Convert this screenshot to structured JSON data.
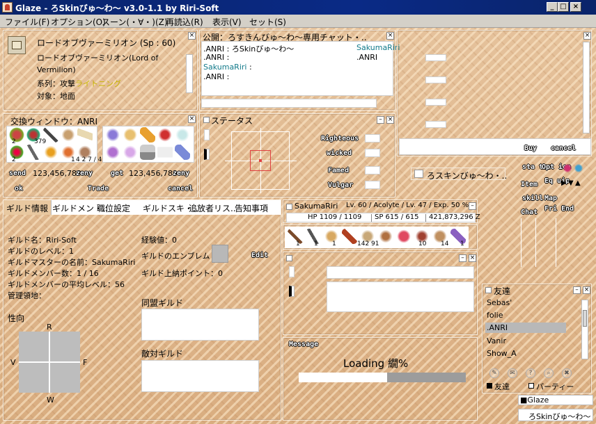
{
  "window": {
    "title": "Glaze - ろSkinびゅ～わ～ v3.0-1.1 by Riri-Soft",
    "min_icon": "minimize-icon",
    "max_icon": "maximize-icon",
    "close_icon": "close-icon"
  },
  "menu": [
    "ファイル(F)",
    "オプション(O)",
    "スーン(・∀・)(Z)",
    "再読込(R)",
    "表示(V)",
    "セット(S)"
  ],
  "skill_window": {
    "name": "ロードオブヴァーミリオン (Sp : 60)",
    "desc1": "ロードオブヴァーミリオン(Lord of",
    "desc2": "Vermilion)",
    "type_label": "系列：攻撃",
    "type_value": "ライトニング",
    "target": "対象：地面"
  },
  "chat_window": {
    "title": "公開：ろすきんびゅ～わ～専用チャット・..",
    "lines": [
      {
        "speaker": ".ANRI",
        "text": ": ろSkinびゅ～わ～",
        "speaker2": "SakumaRiri"
      },
      {
        "speaker": ".ANRI",
        "text": ":",
        "speaker2": ".ANRI"
      },
      {
        "speaker": "SakumaRiri",
        "text": ":",
        "speaker2": ""
      },
      {
        "speaker": ".ANRI",
        "text": ":",
        "speaker2": ""
      }
    ]
  },
  "trade_window": {
    "title": "交換ウィンドウ：ANRI",
    "left_counts": [
      "2",
      "379",
      "",
      "",
      "",
      "2",
      "",
      "",
      "1",
      "4"
    ],
    "right_counts": [
      "",
      "",
      "",
      "",
      "",
      "",
      "",
      "",
      "",
      ""
    ],
    "send_label": "send",
    "send_zeny": "123,456,789",
    "get_label": "get",
    "get_zeny": "123,456,789",
    "zeny_label": "zeny",
    "ok_label": "ok",
    "trade_label": "Trade",
    "cancel_label": "cancel"
  },
  "status_window": {
    "title": "ステータス",
    "righteous": "Righteous",
    "wicked": "wicked",
    "famed": "Famed",
    "vulgar": "Vulgar"
  },
  "shop_window": {
    "buy_label": "Buy",
    "cancel_label": "cancel"
  },
  "chat_room": {
    "label": "ろスキンびゅ～わ・.."
  },
  "menu_buttons": {
    "status": "sta tus",
    "option": "Opt ion",
    "item": "Item",
    "equip": "Eq uip",
    "skill": "skill",
    "map": "Map",
    "chat": "Chat",
    "friend": "Fri End"
  },
  "guild_window": {
    "tabs": [
      "ギルド情報",
      "ギルドメン・..",
      "職位設定",
      "ギルドスキ・..",
      "追放者リス..",
      "告知事項"
    ],
    "name": "ギルド名：Riri-Soft",
    "level": "ギルドのレベル：1",
    "master": "ギルドマスターの名前：SakumaRiri",
    "members": "ギルドメンバー数：1 / 16",
    "avg_level": "ギルドメンバーの平均レベル：56",
    "territory": "管理領地：",
    "exp": "経験値：0",
    "emblem": "ギルドのエンブレム",
    "edit_label": "Edit",
    "tax": "ギルド上納ポイント：0",
    "ally": "同盟ギルド",
    "enemy": "敵対ギルド",
    "tendency": "性向",
    "r": "R",
    "v": "V",
    "f": "F",
    "w": "W"
  },
  "char_window": {
    "name": "SakumaRiri",
    "info": "Lv. 60 / Acolyte / Lv. 47 / Exp. 50 %",
    "hp": "HP  1109 / 1109",
    "sp": "SP  615 / 615",
    "zeny": "421,873,296 Z",
    "hotbar_counts": [
      "1",
      "1",
      "1",
      "142",
      "91",
      "",
      "",
      "10",
      "14",
      "1"
    ]
  },
  "message_window": {
    "title": "Message",
    "loading": "Loading 繝%",
    "progress": 0.47
  },
  "friend_window": {
    "title": "友達",
    "friends": [
      "Sebas'",
      "folie",
      ".ANRI",
      "Vanir",
      "Show_A"
    ],
    "selected_index": 2,
    "tab_friend": "友達",
    "tab_party": "パーティー"
  },
  "taskbar": {
    "item1": "■Glaze",
    "item2": "ろSkinびゅ～わ～"
  },
  "colors": {
    "titlebar": "#0a246a",
    "type_value": "#c8b400",
    "chat_name": "#127a8a"
  }
}
